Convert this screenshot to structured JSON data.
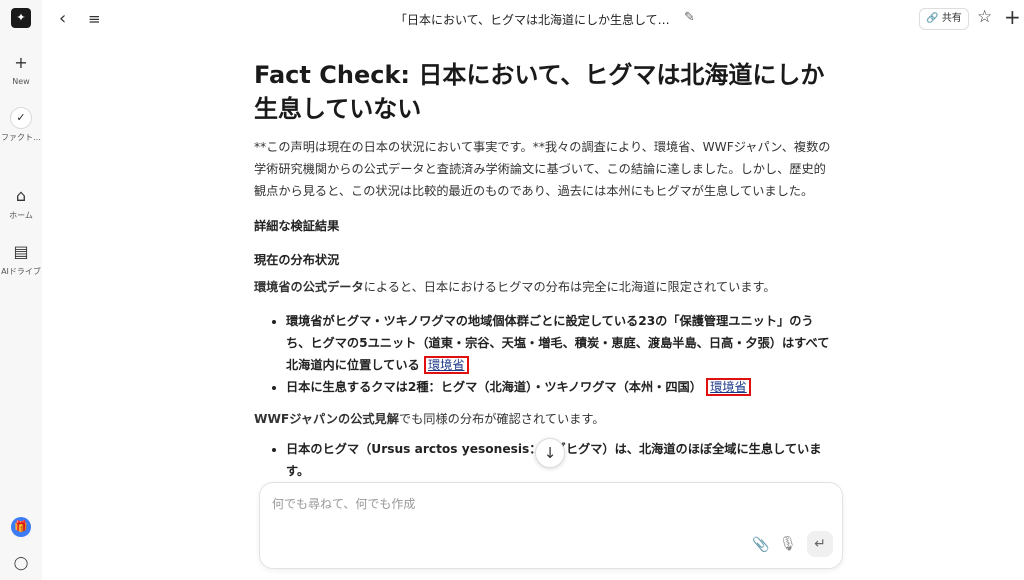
{
  "sidebar": {
    "logo_icon": "sparkle-logo-icon",
    "items": [
      {
        "label": "New",
        "icon": "plus-icon"
      },
      {
        "label": "ファクト…",
        "icon": "fact-check-icon"
      },
      {
        "label": "ホーム",
        "icon": "home-icon"
      },
      {
        "label": "AIドライブ",
        "icon": "folder-icon"
      }
    ]
  },
  "topbar": {
    "title": "「日本において、ヒグマは北海道にしか生息して…",
    "share_label": "共有"
  },
  "article": {
    "title": "Fact Check: 日本において、ヒグマは北海道にしか生息していない",
    "intro": "**この声明は現在の日本の状況において事実です。**我々の調査により、環境省、WWFジャパン、複数の学術研究機関からの公式データと査読済み学術論文に基づいて、この結論に達しました。しかし、歴史的観点から見ると、この状況は比較的最近のものであり、過去には本州にもヒグマが生息していました。",
    "section1": "詳細な検証結果",
    "section2": "現在の分布状況",
    "para1_bold": "環境省の公式データ",
    "para1_rest": "によると、日本におけるヒグマの分布は完全に北海道に限定されています。",
    "bullets1": [
      {
        "text": "環境省がヒグマ・ツキノワグマの地域個体群ごとに設定している23の「保護管理ユニット」のうち、ヒグマの5ユニット（道東・宗谷、天塩・増毛、積炭・恵庭、渡島半島、日高・夕張）はすべて北海道内に位置している",
        "source": "環境省"
      },
      {
        "text": "日本に生息するクマは2種：ヒグマ（北海道）・ツキノワグマ（本州・四国）",
        "source": "環境省"
      }
    ],
    "para2_bold": "WWFジャパンの公式見解",
    "para2_rest": "でも同様の分布が確認されています。",
    "bullets2": [
      {
        "text": "日本のヒグマ（Ursus arctos yesonesis：エゾヒグマ）は、北海道のほぼ全域に生息しています。"
      }
    ]
  },
  "composer": {
    "placeholder": "何でも尋ねて、何でも作成"
  }
}
